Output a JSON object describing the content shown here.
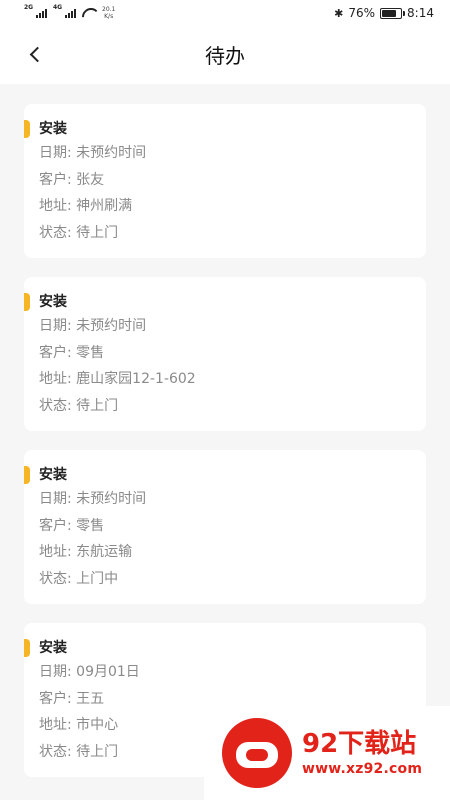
{
  "status_bar": {
    "net1": "2G",
    "net2": "4G",
    "speed_value": "20.1",
    "speed_unit": "K/s",
    "battery_pct_text": "76%",
    "battery_level": 0.76,
    "time": "8:14"
  },
  "header": {
    "title": "待办"
  },
  "tasks": [
    {
      "type": "安装",
      "date_label": "日期:",
      "date": "未预约时间",
      "customer_label": "客户:",
      "customer": "张友",
      "address_label": "地址:",
      "address": "神州刷满",
      "status_label": "状态:",
      "status": "待上门"
    },
    {
      "type": "安装",
      "date_label": "日期:",
      "date": "未预约时间",
      "customer_label": "客户:",
      "customer": "零售",
      "address_label": "地址:",
      "address": "鹿山家园12-1-602",
      "status_label": "状态:",
      "status": "待上门"
    },
    {
      "type": "安装",
      "date_label": "日期:",
      "date": "未预约时间",
      "customer_label": "客户:",
      "customer": "零售",
      "address_label": "地址:",
      "address": "东航运输",
      "status_label": "状态:",
      "status": "上门中"
    },
    {
      "type": "安装",
      "date_label": "日期:",
      "date": "09月01日",
      "customer_label": "客户:",
      "customer": "王五",
      "address_label": "地址:",
      "address": "市中心",
      "status_label": "状态:",
      "status": "待上门"
    }
  ],
  "watermark": {
    "name": "92下载站",
    "url": "www.xz92.com"
  },
  "colors": {
    "accent": "#f6b525",
    "watermark": "#e2231a"
  }
}
